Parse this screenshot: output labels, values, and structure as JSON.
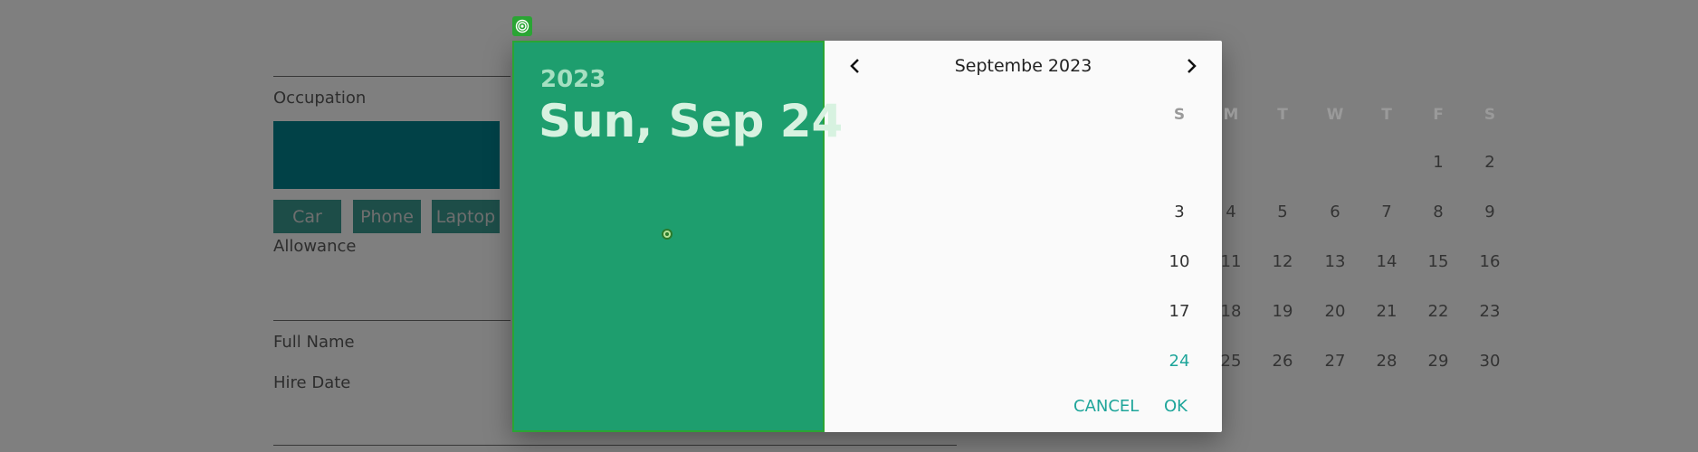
{
  "form": {
    "occupation_label": "Occupation",
    "chips": [
      "Car",
      "Phone",
      "Laptop"
    ],
    "allowance_label": "Allowance",
    "full_name_label": "Full Name",
    "hire_date_label": "Hire Date"
  },
  "picker": {
    "header_year": "2023",
    "header_date": "Sun, Sep 24",
    "month_label": "Septembe 2023",
    "weekdays": [
      "S",
      "M",
      "T",
      "W",
      "T",
      "F",
      "S"
    ],
    "days": [
      "1",
      "2",
      "3",
      "4",
      "5",
      "6",
      "7",
      "8",
      "9",
      "10",
      "11",
      "12",
      "13",
      "14",
      "15",
      "16",
      "17",
      "18",
      "19",
      "20",
      "21",
      "22",
      "23",
      "24",
      "25",
      "26",
      "27",
      "28",
      "29",
      "30"
    ],
    "first_weekday_index": 5,
    "selected_day": "24",
    "cancel_label": "CANCEL",
    "ok_label": "OK"
  },
  "colors": {
    "header_bg": "#1e9e6e",
    "accent": "#1ea59a",
    "occupation_box": "#03838f",
    "chip_bg": "#3b9b90"
  },
  "icons": {
    "prev": "chevron-left-icon",
    "next": "chevron-right-icon",
    "badge": "target-icon"
  }
}
